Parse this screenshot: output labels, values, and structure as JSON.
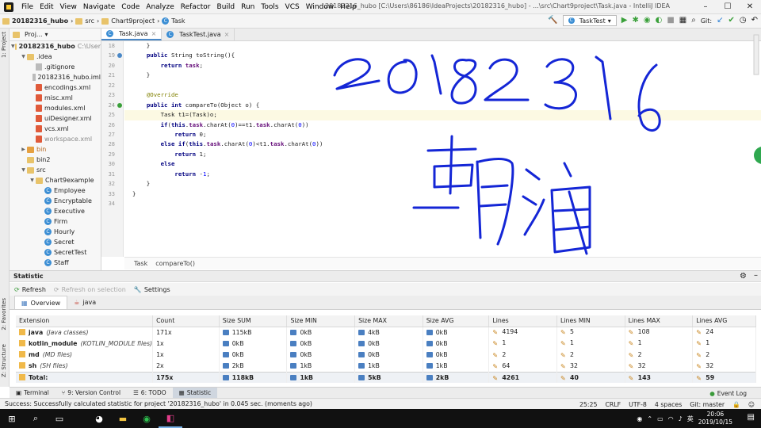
{
  "menubar": {
    "items": [
      "File",
      "Edit",
      "View",
      "Navigate",
      "Code",
      "Analyze",
      "Refactor",
      "Build",
      "Run",
      "Tools",
      "VCS",
      "Window",
      "Help"
    ],
    "window_title": "20182316_hubo [C:\\Users\\86186\\IdeaProjects\\20182316_hubo] - ...\\src\\Chart9project\\Task.java - IntelliJ IDEA"
  },
  "navbar": {
    "crumbs": [
      "20182316_hubo",
      "src",
      "Chart9project",
      "Task"
    ],
    "run_config": "TaskTest",
    "git_label": "Git:"
  },
  "side_labels": {
    "project": "1: Project",
    "favorites": "2: Favorites",
    "structure": "Z: Structure"
  },
  "project": {
    "header": "Proj...",
    "nodes": [
      {
        "label": "20182316_hubo",
        "extra": "C:\\User",
        "indent": 0,
        "arrow": "▼",
        "icon": "folder",
        "bold": true
      },
      {
        "label": ".idea",
        "indent": 1,
        "arrow": "▼",
        "icon": "folder"
      },
      {
        "label": ".gitignore",
        "indent": 2,
        "arrow": "",
        "icon": "gray"
      },
      {
        "label": "20182316_hubo.iml",
        "indent": 2,
        "arrow": "",
        "icon": "gray"
      },
      {
        "label": "encodings.xml",
        "indent": 2,
        "arrow": "",
        "icon": "xml"
      },
      {
        "label": "misc.xml",
        "indent": 2,
        "arrow": "",
        "icon": "xml"
      },
      {
        "label": "modules.xml",
        "indent": 2,
        "arrow": "",
        "icon": "xml"
      },
      {
        "label": "uiDesigner.xml",
        "indent": 2,
        "arrow": "",
        "icon": "xml"
      },
      {
        "label": "vcs.xml",
        "indent": 2,
        "arrow": "",
        "icon": "xml"
      },
      {
        "label": "workspace.xml",
        "indent": 2,
        "arrow": "",
        "icon": "xml",
        "muted": true
      },
      {
        "label": "bin",
        "indent": 1,
        "arrow": "▶",
        "icon": "folder",
        "orange": true
      },
      {
        "label": "bin2",
        "indent": 1,
        "arrow": "",
        "icon": "folder"
      },
      {
        "label": "src",
        "indent": 1,
        "arrow": "▼",
        "icon": "folder"
      },
      {
        "label": "Chart9example",
        "indent": 2,
        "arrow": "▼",
        "icon": "folder"
      },
      {
        "label": "Employee",
        "indent": 3,
        "arrow": "",
        "icon": "class"
      },
      {
        "label": "Encryptable",
        "indent": 3,
        "arrow": "",
        "icon": "class"
      },
      {
        "label": "Executive",
        "indent": 3,
        "arrow": "",
        "icon": "class"
      },
      {
        "label": "Firm",
        "indent": 3,
        "arrow": "",
        "icon": "class"
      },
      {
        "label": "Hourly",
        "indent": 3,
        "arrow": "",
        "icon": "class"
      },
      {
        "label": "Secret",
        "indent": 3,
        "arrow": "",
        "icon": "class"
      },
      {
        "label": "SecretTest",
        "indent": 3,
        "arrow": "",
        "icon": "class"
      },
      {
        "label": "Staff",
        "indent": 3,
        "arrow": "",
        "icon": "class"
      }
    ]
  },
  "editor": {
    "tabs": [
      {
        "label": "Task.java",
        "active": true
      },
      {
        "label": "TaskTest.java",
        "active": false
      }
    ],
    "lines": [
      {
        "n": "18",
        "code": "    }"
      },
      {
        "n": "19",
        "code": "    public String toString(){",
        "mark": "up"
      },
      {
        "n": "20",
        "code": "        return task;"
      },
      {
        "n": "21",
        "code": "    }"
      },
      {
        "n": "22",
        "code": ""
      },
      {
        "n": "23",
        "code": "    @Override"
      },
      {
        "n": "24",
        "code": "    public int compareTo(Object o) {",
        "mark": "impl"
      },
      {
        "n": "25",
        "code": "        Task t1=(Task)o;",
        "hl": true
      },
      {
        "n": "26",
        "code": "        if(this.task.charAt(0)==t1.task.charAt(0))"
      },
      {
        "n": "27",
        "code": "            return 0;"
      },
      {
        "n": "28",
        "code": "        else if(this.task.charAt(0)<t1.task.charAt(0))"
      },
      {
        "n": "29",
        "code": "            return 1;"
      },
      {
        "n": "30",
        "code": "        else"
      },
      {
        "n": "31",
        "code": "            return -1;"
      },
      {
        "n": "32",
        "code": "    }"
      },
      {
        "n": "33",
        "code": "}"
      },
      {
        "n": "34",
        "code": ""
      }
    ],
    "crumbs": [
      "Task",
      "compareTo()"
    ]
  },
  "statistic": {
    "title": "Statistic",
    "toolbar": {
      "refresh": "Refresh",
      "refresh_selection": "Refresh on selection",
      "settings": "Settings"
    },
    "tabs": [
      {
        "label": "Overview",
        "active": true
      },
      {
        "label": "java",
        "active": false
      }
    ],
    "columns": [
      "Extension",
      "Count",
      "Size SUM",
      "Size MIN",
      "Size MAX",
      "Size AVG",
      "Lines",
      "Lines MIN",
      "Lines MAX",
      "Lines AVG"
    ],
    "rows": [
      {
        "ext": "java",
        "desc": "(Java classes)",
        "count": "171x",
        "sum": "115kB",
        "min": "0kB",
        "max": "4kB",
        "avg": "0kB",
        "lines": "4194",
        "lmin": "5",
        "lmax": "108",
        "lavg": "24"
      },
      {
        "ext": "kotlin_module",
        "desc": "(KOTLIN_MODULE files)",
        "count": "1x",
        "sum": "0kB",
        "min": "0kB",
        "max": "0kB",
        "avg": "0kB",
        "lines": "1",
        "lmin": "1",
        "lmax": "1",
        "lavg": "1"
      },
      {
        "ext": "md",
        "desc": "(MD files)",
        "count": "1x",
        "sum": "0kB",
        "min": "0kB",
        "max": "0kB",
        "avg": "0kB",
        "lines": "2",
        "lmin": "2",
        "lmax": "2",
        "lavg": "2"
      },
      {
        "ext": "sh",
        "desc": "(SH files)",
        "count": "2x",
        "sum": "2kB",
        "min": "1kB",
        "max": "1kB",
        "avg": "1kB",
        "lines": "64",
        "lmin": "32",
        "lmax": "32",
        "lavg": "32"
      }
    ],
    "total": {
      "ext": "Total:",
      "count": "175x",
      "sum": "118kB",
      "min": "1kB",
      "max": "5kB",
      "avg": "2kB",
      "lines": "4261",
      "lmin": "40",
      "lmax": "143",
      "lavg": "59"
    }
  },
  "bottom_tools": {
    "items": [
      {
        "label": "Terminal",
        "active": false
      },
      {
        "label": "9: Version Control",
        "active": false
      },
      {
        "label": "6: TODO",
        "active": false
      },
      {
        "label": "Statistic",
        "active": true
      }
    ],
    "event_log": "Event Log"
  },
  "statusbar": {
    "message": "Success: Successfully calculated statistic for project '20182316_hubo' in 0.045 sec. (moments ago)",
    "position": "25:25",
    "line_sep": "CRLF",
    "encoding": "UTF-8",
    "indent": "4 spaces",
    "git": "Git: master"
  },
  "taskbar": {
    "time": "20:06",
    "date": "2019/10/15",
    "lang": "英"
  },
  "colors": {
    "ink": "#1426d6",
    "accent": "#4a88c7"
  }
}
